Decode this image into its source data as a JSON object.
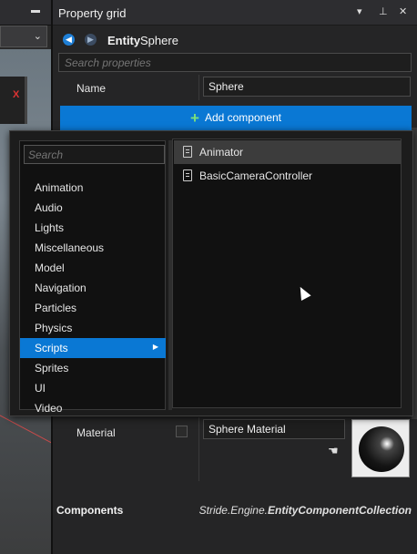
{
  "panel": {
    "title": "Property grid",
    "entity_label": "Entity",
    "entity_name": "Sphere",
    "search_placeholder": "Search properties"
  },
  "name_row": {
    "label": "Name",
    "value": "Sphere"
  },
  "add_component": {
    "label": "Add component"
  },
  "popup": {
    "search_placeholder": "Search",
    "categories": [
      {
        "label": "Animation"
      },
      {
        "label": "Audio"
      },
      {
        "label": "Lights"
      },
      {
        "label": "Miscellaneous"
      },
      {
        "label": "Model"
      },
      {
        "label": "Navigation"
      },
      {
        "label": "Particles"
      },
      {
        "label": "Physics"
      },
      {
        "label": "Scripts",
        "selected": true
      },
      {
        "label": "Sprites"
      },
      {
        "label": "UI"
      },
      {
        "label": "Video"
      }
    ],
    "scripts": [
      {
        "label": "Animator",
        "hovered": true
      },
      {
        "label": "BasicCameraController"
      }
    ]
  },
  "material_row": {
    "label": "Material",
    "value": "Sphere Material"
  },
  "components_row": {
    "label": "Components",
    "type_prefix": "Stride.Engine.",
    "type_name": "EntityComponentCollection"
  },
  "colors": {
    "accent": "#0a78d4",
    "plus": "#7be07b"
  },
  "icons": [
    "pin-icon",
    "close-icon",
    "dropdown-icon",
    "back-icon",
    "forward-icon",
    "script-icon",
    "hand-icon",
    "chevron-down-icon"
  ]
}
